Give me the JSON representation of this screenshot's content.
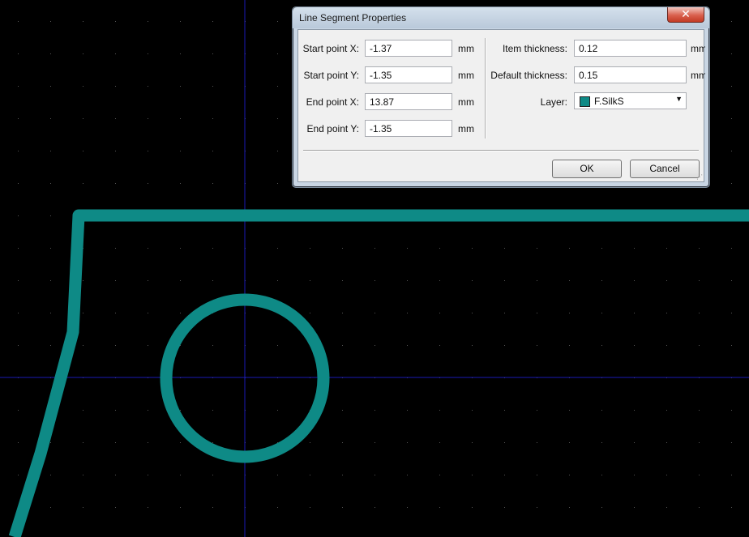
{
  "dialog": {
    "title": "Line Segment Properties",
    "close_glyph": "✕",
    "fields_left": [
      {
        "label": "Start point X:",
        "value": "-1.37",
        "unit": "mm"
      },
      {
        "label": "Start point Y:",
        "value": "-1.35",
        "unit": "mm"
      },
      {
        "label": "End point X:",
        "value": "13.87",
        "unit": "mm"
      },
      {
        "label": "End point Y:",
        "value": "-1.35",
        "unit": "mm"
      }
    ],
    "fields_right": [
      {
        "label": "Item thickness:",
        "value": "0.12",
        "unit": "mm"
      },
      {
        "label": "Default thickness:",
        "value": "0.15",
        "unit": "mm"
      }
    ],
    "layer": {
      "label": "Layer:",
      "value": "F.SilkS",
      "swatch_color": "#0e8a86"
    },
    "ok_label": "OK",
    "cancel_label": "Cancel"
  },
  "pcb": {
    "background": "#000000",
    "trace_color": "#0e8a86",
    "crosshair_color": "#1a1ab4",
    "grid_color": "#555555"
  }
}
